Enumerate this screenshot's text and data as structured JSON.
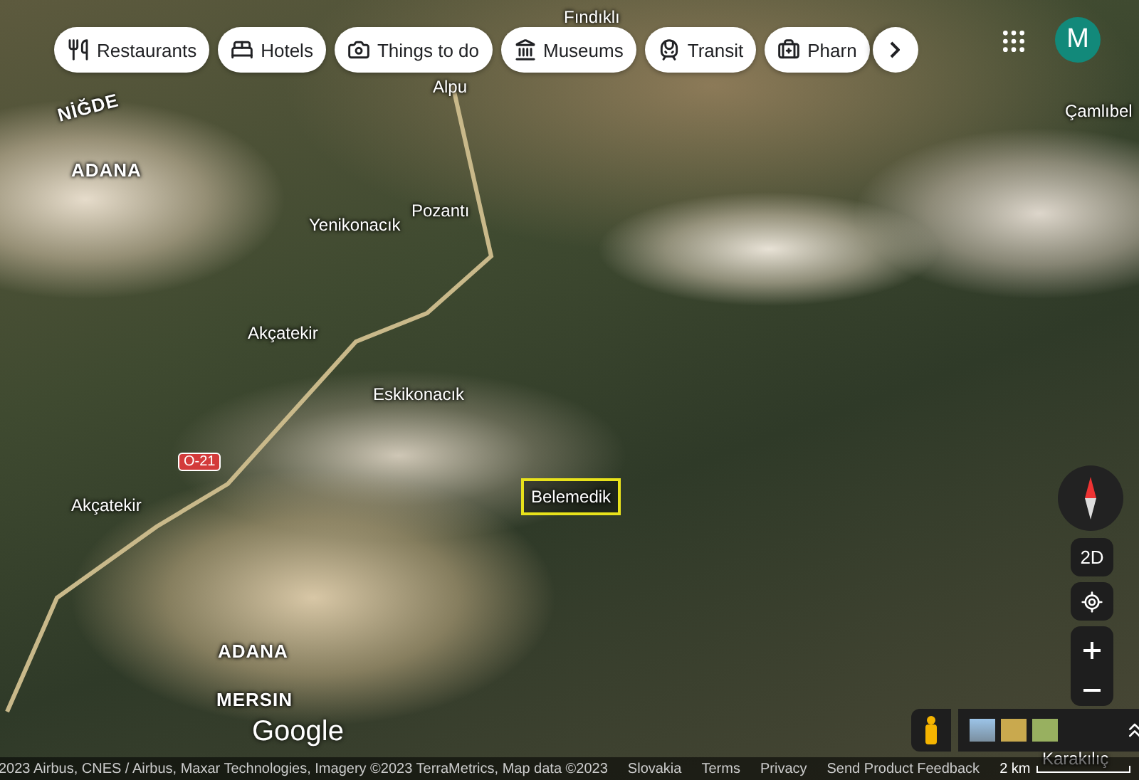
{
  "chips": [
    {
      "label": "Restaurants",
      "kind": "restaurant"
    },
    {
      "label": "Hotels",
      "kind": "hotel"
    },
    {
      "label": "Things to do",
      "kind": "camera"
    },
    {
      "label": "Museums",
      "kind": "museum"
    },
    {
      "label": "Transit",
      "kind": "transit"
    },
    {
      "label": "Pharn",
      "kind": "pharmacy"
    }
  ],
  "avatar": "M",
  "map_labels": [
    {
      "text": "Fındıklı",
      "kind": "place"
    },
    {
      "text": "Alpu",
      "kind": "place"
    },
    {
      "text": "Çamlıbel",
      "kind": "place"
    },
    {
      "text": "NİĞDE",
      "kind": "region"
    },
    {
      "text": "ADANA",
      "kind": "region"
    },
    {
      "text": "Yenikonacık",
      "kind": "place"
    },
    {
      "text": "Pozantı",
      "kind": "place"
    },
    {
      "text": "Akçatekir",
      "kind": "place"
    },
    {
      "text": "Eskikonacık",
      "kind": "place"
    },
    {
      "text": "O-21",
      "kind": "road"
    },
    {
      "text": "Akçatekir",
      "kind": "place"
    },
    {
      "text": "Belemedik",
      "kind": "highlight"
    },
    {
      "text": "ADANA",
      "kind": "region"
    },
    {
      "text": "MERSIN",
      "kind": "region"
    },
    {
      "text": "Karakılıç",
      "kind": "place"
    }
  ],
  "view_button": "2D",
  "logo": "Google",
  "attribution": "2023 Airbus, CNES / Airbus, Maxar Technologies, Imagery ©2023 TerraMetrics, Map data ©2023",
  "footer_links": [
    "Slovakia",
    "Terms",
    "Privacy",
    "Send Product Feedback"
  ],
  "scale": "2 km"
}
